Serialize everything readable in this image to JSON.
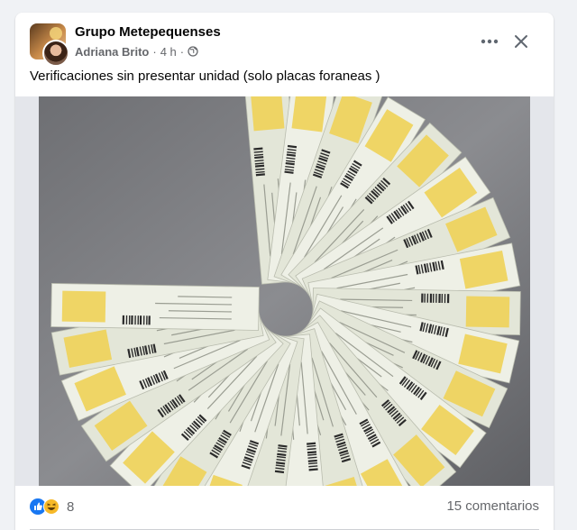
{
  "post": {
    "group_name": "Grupo Metepequenses",
    "author": "Adriana Brito",
    "time": "4 h",
    "separator": "·",
    "text": "Verificaciones sin presentar unidad (solo placas foraneas )",
    "privacy_icon": "globe-icon",
    "more_icon": "more-options-icon",
    "close_icon": "close-icon"
  },
  "photo": {
    "subject": "fan of vehicle verification certificates with yellow holograms"
  },
  "footer": {
    "reactions": [
      "like-icon",
      "haha-icon"
    ],
    "reaction_count": "8",
    "comments": "15 comentarios"
  },
  "colors": {
    "page_bg": "#f0f2f5",
    "card_bg": "#ffffff",
    "primary_text": "#050505",
    "secondary_text": "#65676b",
    "like_blue": "#1877f2",
    "haha_yellow": "#f7b928"
  }
}
